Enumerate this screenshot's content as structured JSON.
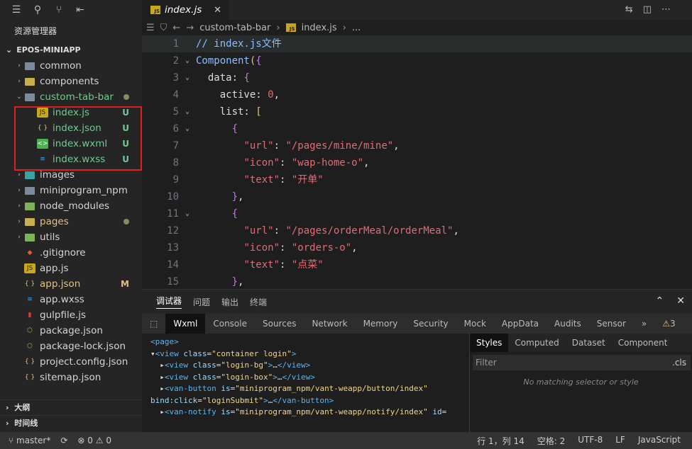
{
  "sidebar": {
    "title": "资源管理器",
    "project": "EPOS-MINIAPP",
    "items": [
      {
        "label": "common",
        "kind": "folder",
        "chev": "›",
        "indent": 0,
        "color": "#d4d4d4",
        "icon_color": "#7d8a99"
      },
      {
        "label": "components",
        "kind": "folder",
        "chev": "›",
        "indent": 0,
        "color": "#d4d4d4",
        "icon_color": "#c8b04a"
      },
      {
        "label": "custom-tab-bar",
        "kind": "folder-open",
        "chev": "⌄",
        "indent": 0,
        "color": "#73c991",
        "icon_color": "#7d8a99",
        "dot": true
      },
      {
        "label": "index.js",
        "kind": "js",
        "indent": 1,
        "color": "#73c991",
        "status": "U"
      },
      {
        "label": "index.json",
        "kind": "json",
        "indent": 1,
        "color": "#73c991",
        "status": "U"
      },
      {
        "label": "index.wxml",
        "kind": "wxml",
        "indent": 1,
        "color": "#73c991",
        "status": "U"
      },
      {
        "label": "index.wxss",
        "kind": "wxss",
        "indent": 1,
        "color": "#73c991",
        "status": "U"
      },
      {
        "label": "images",
        "kind": "folder",
        "chev": "›",
        "indent": 0,
        "color": "#d4d4d4",
        "icon_color": "#3aa5a0"
      },
      {
        "label": "miniprogram_npm",
        "kind": "folder",
        "chev": "›",
        "indent": 0,
        "color": "#d4d4d4",
        "icon_color": "#7d8a99"
      },
      {
        "label": "node_modules",
        "kind": "folder",
        "chev": "›",
        "indent": 0,
        "color": "#d4d4d4",
        "icon_color": "#7fb35a"
      },
      {
        "label": "pages",
        "kind": "folder",
        "chev": "›",
        "indent": 0,
        "color": "#e2c08d",
        "icon_color": "#c8b04a",
        "dot": true
      },
      {
        "label": "utils",
        "kind": "folder",
        "chev": "›",
        "indent": 0,
        "color": "#d4d4d4",
        "icon_color": "#7fb35a"
      },
      {
        "label": ".gitignore",
        "kind": "git",
        "indent": 0,
        "color": "#d4d4d4"
      },
      {
        "label": "app.js",
        "kind": "js",
        "indent": 0,
        "color": "#d4d4d4"
      },
      {
        "label": "app.json",
        "kind": "json",
        "indent": 0,
        "color": "#e2c08d",
        "status": "M"
      },
      {
        "label": "app.wxss",
        "kind": "wxss",
        "indent": 0,
        "color": "#d4d4d4"
      },
      {
        "label": "gulpfile.js",
        "kind": "gulp",
        "indent": 0,
        "color": "#d4d4d4"
      },
      {
        "label": "package.json",
        "kind": "pkg",
        "indent": 0,
        "color": "#d4d4d4"
      },
      {
        "label": "package-lock.json",
        "kind": "pkg",
        "indent": 0,
        "color": "#d4d4d4"
      },
      {
        "label": "project.config.json",
        "kind": "json",
        "indent": 0,
        "color": "#d4d4d4"
      },
      {
        "label": "sitemap.json",
        "kind": "json",
        "indent": 0,
        "color": "#d4d4d4"
      }
    ],
    "outline": "大纲",
    "timeline": "时间线"
  },
  "editor": {
    "tab": "index.js",
    "breadcrumb": [
      "custom-tab-bar",
      "index.js",
      "..."
    ],
    "lines": [
      {
        "n": "1",
        "fold": "",
        "html": "<span class='cmt'>// index.js文件</span>",
        "cur": true
      },
      {
        "n": "2",
        "fold": "⌄",
        "html": "<span class='kw-c'>Component</span><span class='b1'>(</span><span class='b2'>{</span>"
      },
      {
        "n": "3",
        "fold": "⌄",
        "html": "  <span class='p'>data: </span><span class='b2'>{</span>"
      },
      {
        "n": "4",
        "fold": "",
        "html": "    <span class='p'>active: </span><span class='n'>0</span><span class='p'>,</span>"
      },
      {
        "n": "5",
        "fold": "⌄",
        "html": "    <span class='p'>list: </span><span class='b1'>[</span>"
      },
      {
        "n": "6",
        "fold": "⌄",
        "html": "      <span class='b2'>{</span>"
      },
      {
        "n": "7",
        "fold": "",
        "html": "        <span class='s'>\"url\"</span><span class='p'>: </span><span class='s'>\"/pages/mine/mine\"</span><span class='p'>,</span>"
      },
      {
        "n": "8",
        "fold": "",
        "html": "        <span class='s'>\"icon\"</span><span class='p'>: </span><span class='s'>\"wap-home-o\"</span><span class='p'>,</span>"
      },
      {
        "n": "9",
        "fold": "",
        "html": "        <span class='s'>\"text\"</span><span class='p'>: </span><span class='s'>\"开单\"</span>"
      },
      {
        "n": "10",
        "fold": "",
        "html": "      <span class='b2'>}</span><span class='p'>,</span>"
      },
      {
        "n": "11",
        "fold": "⌄",
        "html": "      <span class='b2'>{</span>"
      },
      {
        "n": "12",
        "fold": "",
        "html": "        <span class='s'>\"url\"</span><span class='p'>: </span><span class='s'>\"/pages/orderMeal/orderMeal\"</span><span class='p'>,</span>"
      },
      {
        "n": "13",
        "fold": "",
        "html": "        <span class='s'>\"icon\"</span><span class='p'>: </span><span class='s'>\"orders-o\"</span><span class='p'>,</span>"
      },
      {
        "n": "14",
        "fold": "",
        "html": "        <span class='s'>\"text\"</span><span class='p'>: </span><span class='s'>\"点菜\"</span>"
      },
      {
        "n": "15",
        "fold": "",
        "html": "      <span class='b2'>}</span><span class='p'>,</span>"
      }
    ]
  },
  "devtools": {
    "top_tabs": [
      "调试器",
      "问题",
      "输出",
      "终端"
    ],
    "tabs": [
      "Wxml",
      "Console",
      "Sources",
      "Network",
      "Memory",
      "Security",
      "Mock",
      "AppData",
      "Audits",
      "Sensor"
    ],
    "warnings": "3",
    "dom": [
      "<span class='tg'>&lt;page&gt;</span>",
      "<span class='tx'>▾</span><span class='tg'>&lt;view </span><span class='at'>class</span><span class='tx'>=</span><span class='av'>\"container login\"</span><span class='tg'>&gt;</span>",
      "&nbsp;&nbsp;<span class='tx'>▸</span><span class='tg'>&lt;view </span><span class='at'>class</span><span class='tx'>=</span><span class='av'>\"login-bg\"</span><span class='tg'>&gt;</span><span class='tx'>…</span><span class='tg'>&lt;/view&gt;</span>",
      "&nbsp;&nbsp;<span class='tx'>▸</span><span class='tg'>&lt;view </span><span class='at'>class</span><span class='tx'>=</span><span class='av'>\"login-box\"</span><span class='tg'>&gt;</span><span class='tx'>…</span><span class='tg'>&lt;/view&gt;</span>",
      "&nbsp;&nbsp;<span class='tx'>▸</span><span class='tg'>&lt;van-button </span><span class='at'>is</span><span class='tx'>=</span><span class='av'>\"miniprogram_npm/vant-weapp/button/index\"</span>",
      "<span class='at'>bind:click</span><span class='tx'>=</span><span class='av'>\"loginSubmit\"</span><span class='tg'>&gt;</span><span class='tx'>…</span><span class='tg'>&lt;/van-button&gt;</span>",
      "&nbsp;&nbsp;<span class='tx'>▸</span><span class='tg'>&lt;van-notify </span><span class='at'>is</span><span class='tx'>=</span><span class='av'>\"miniprogram_npm/vant-weapp/notify/index\"</span> <span class='at'>id</span><span class='tx'>=</span>"
    ],
    "style_tabs": [
      "Styles",
      "Computed",
      "Dataset",
      "Component Data"
    ],
    "filter_placeholder": "Filter",
    "cls": ".cls",
    "no_match": "No matching selector or style"
  },
  "status": {
    "branch": "master*",
    "errors": "0",
    "warnings": "0",
    "position": "行 1，列 14",
    "spaces": "空格: 2",
    "encoding": "UTF-8",
    "eol": "LF",
    "language": "JavaScript",
    "extra": "6"
  }
}
